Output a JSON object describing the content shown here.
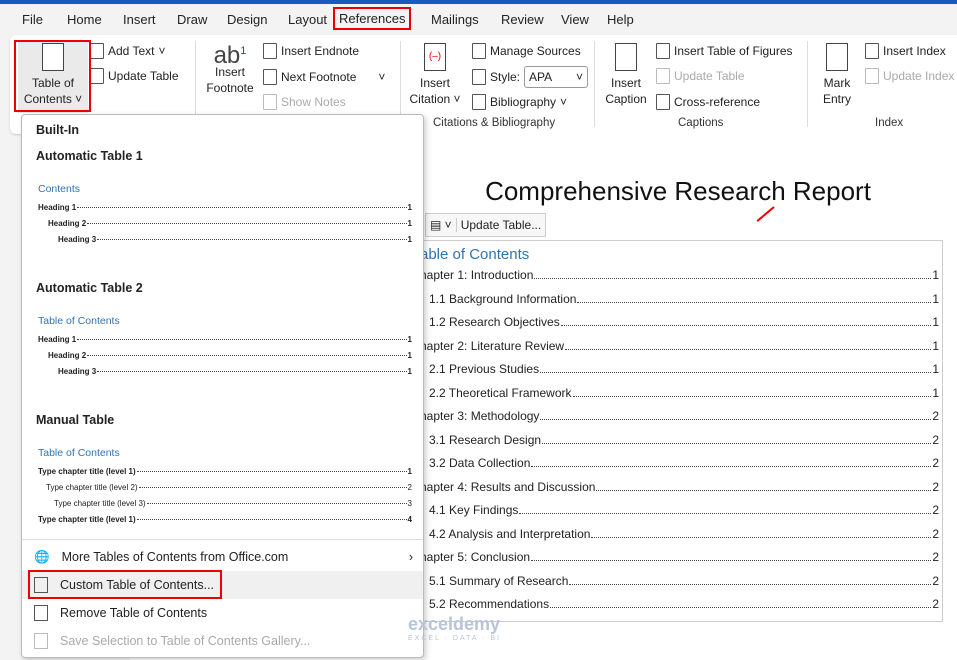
{
  "menu_tabs": [
    "File",
    "Home",
    "Insert",
    "Draw",
    "Design",
    "Layout",
    "References",
    "Mailings",
    "Review",
    "View",
    "Help"
  ],
  "selected_tab": "References",
  "ribbon": {
    "toc": {
      "table_of_contents": "Table of Contents",
      "add_text": "Add Text",
      "update_table": "Update Table"
    },
    "footnotes": {
      "insert_footnote": "Insert Footnote",
      "insert_endnote": "Insert Endnote",
      "next_footnote": "Next Footnote",
      "show_notes": "Show Notes"
    },
    "citations": {
      "insert_citation": "Insert Citation",
      "manage_sources": "Manage Sources",
      "style_label": "Style:",
      "style_value": "APA",
      "bibliography": "Bibliography",
      "group": "Citations & Bibliography"
    },
    "captions": {
      "insert_caption": "Insert Caption",
      "insert_table_of_figures": "Insert Table of Figures",
      "update_table": "Update Table",
      "cross_reference": "Cross-reference",
      "group": "Captions"
    },
    "index": {
      "mark_entry": "Mark Entry",
      "insert_index": "Insert Index",
      "update_index": "Update Index",
      "group": "Index"
    }
  },
  "dropdown": {
    "built_in": "Built-In",
    "auto1": {
      "label": "Automatic Table 1",
      "heading": "Contents",
      "rows": [
        [
          "Heading 1",
          "1"
        ],
        [
          "Heading 2",
          "1"
        ],
        [
          "Heading 3",
          "1"
        ]
      ]
    },
    "auto2": {
      "label": "Automatic Table 2",
      "heading": "Table of Contents",
      "rows": [
        [
          "Heading 1",
          "1"
        ],
        [
          "Heading 2",
          "1"
        ],
        [
          "Heading 3",
          "1"
        ]
      ]
    },
    "manual": {
      "label": "Manual Table",
      "heading": "Table of Contents",
      "rows": [
        [
          "Type chapter title (level 1)",
          "1"
        ],
        [
          "Type chapter title (level 2)",
          "2"
        ],
        [
          "Type chapter title (level 3)",
          "3"
        ],
        [
          "Type chapter title (level 1)",
          "4"
        ]
      ]
    },
    "more": "More Tables of Contents from Office.com",
    "custom": "Custom Table of Contents...",
    "remove": "Remove Table of Contents",
    "save": "Save Selection to Table of Contents Gallery..."
  },
  "document": {
    "title": "Comprehensive Research Report",
    "update_table_button": "Update Table...",
    "toc_heading": "able of Contents",
    "toc": [
      {
        "text": "hapter 1: Introduction",
        "page": "1",
        "level": 1
      },
      {
        "text": "1.1 Background Information",
        "page": "1",
        "level": 2
      },
      {
        "text": "1.2 Research Objectives",
        "page": "1",
        "level": 2
      },
      {
        "text": "hapter 2: Literature Review",
        "page": "1",
        "level": 1
      },
      {
        "text": "2.1 Previous Studies",
        "page": "1",
        "level": 2
      },
      {
        "text": "2.2 Theoretical Framework",
        "page": "1",
        "level": 2
      },
      {
        "text": "hapter 3: Methodology",
        "page": "2",
        "level": 1
      },
      {
        "text": "3.1 Research Design",
        "page": "2",
        "level": 2
      },
      {
        "text": "3.2 Data Collection",
        "page": "2",
        "level": 2
      },
      {
        "text": "hapter 4: Results and Discussion",
        "page": "2",
        "level": 1
      },
      {
        "text": "4.1 Key Findings",
        "page": "2",
        "level": 2
      },
      {
        "text": "4.2 Analysis and Interpretation",
        "page": "2",
        "level": 2
      },
      {
        "text": "hapter 5: Conclusion",
        "page": "2",
        "level": 1
      },
      {
        "text": "5.1 Summary of Research",
        "page": "2",
        "level": 2
      },
      {
        "text": "5.2 Recommendations",
        "page": "2",
        "level": 2
      }
    ]
  },
  "watermark": {
    "name": "exceldemy",
    "tagline": "EXCEL · DATA · BI"
  },
  "colors": {
    "accent": "#185abd",
    "highlight": "#e00000",
    "toc_heading": "#2e74b5"
  }
}
